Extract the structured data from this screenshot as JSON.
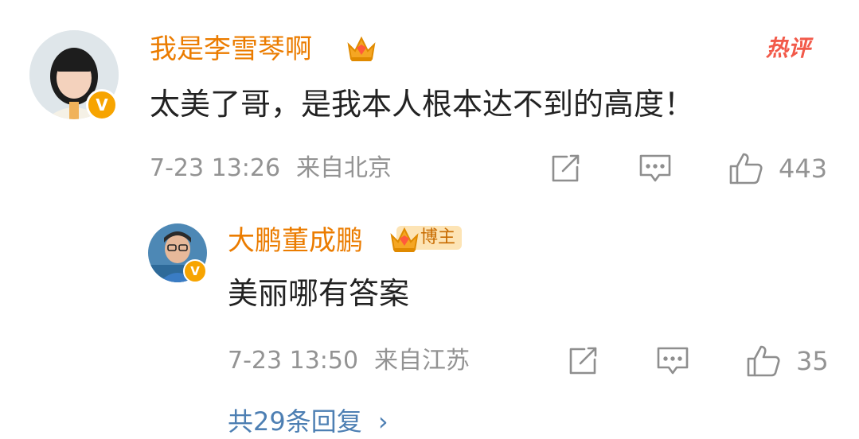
{
  "comment": {
    "username": "我是李雪琴啊",
    "badge_icon": "crown-icon",
    "hot_label": "热评",
    "text": "太美了哥，是我本人根本达不到的高度！",
    "timestamp": "7-23 13:26",
    "location": "来自北京",
    "like_count": "443",
    "accent_color": "#eb7c00"
  },
  "reply": {
    "username": "大鹏董成鹏",
    "tag_label": "博主",
    "text": "美丽哪有答案",
    "timestamp": "7-23 13:50",
    "location": "来自江苏",
    "like_count": "35"
  },
  "footer": {
    "replies_link": "共29条回复"
  }
}
